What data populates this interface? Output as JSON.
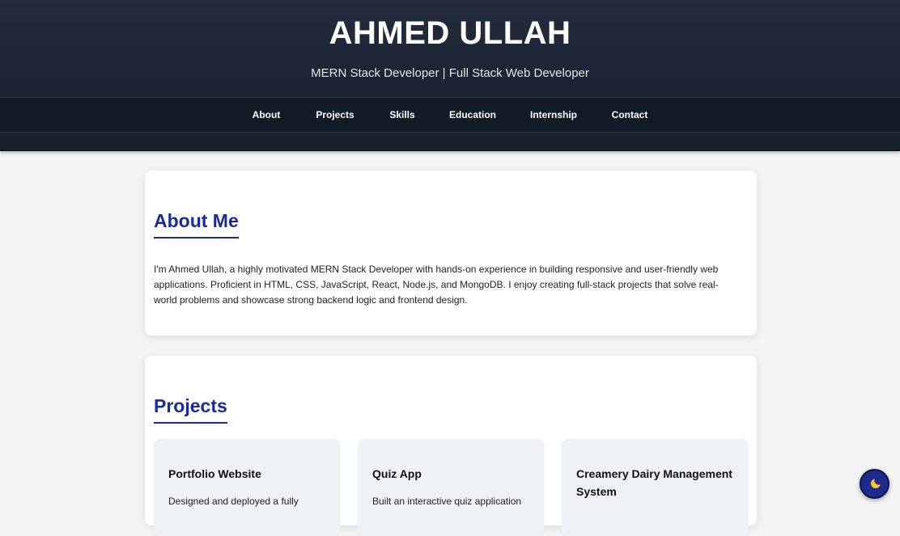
{
  "header": {
    "title": "AHMED ULLAH",
    "subtitle": "MERN Stack Developer | Full Stack Web Developer"
  },
  "nav": {
    "items": [
      {
        "label": "About"
      },
      {
        "label": "Projects"
      },
      {
        "label": "Skills"
      },
      {
        "label": "Education"
      },
      {
        "label": "Internship"
      },
      {
        "label": "Contact"
      }
    ]
  },
  "about": {
    "heading": "About Me",
    "text": "I'm Ahmed Ullah, a highly motivated MERN Stack Developer with hands-on experience in building responsive and user-friendly web applications. Proficient in HTML, CSS, JavaScript, React, Node.js, and MongoDB. I enjoy creating full-stack projects that solve real-world problems and showcase strong backend logic and frontend design."
  },
  "projects": {
    "heading": "Projects",
    "items": [
      {
        "title": "Portfolio Website",
        "description": "Designed and deployed a fully"
      },
      {
        "title": "Quiz App",
        "description": "Built an interactive quiz application"
      },
      {
        "title": "Creamery Dairy Management System",
        "description": ""
      }
    ]
  },
  "theme_toggle": {
    "icon": "moon-icon"
  },
  "colors": {
    "header_bg": "#1b2432",
    "nav_bg": "#121a26",
    "accent": "#1a2a99",
    "page_bg": "#f4f4f4",
    "project_card_bg": "#eef2f7"
  }
}
